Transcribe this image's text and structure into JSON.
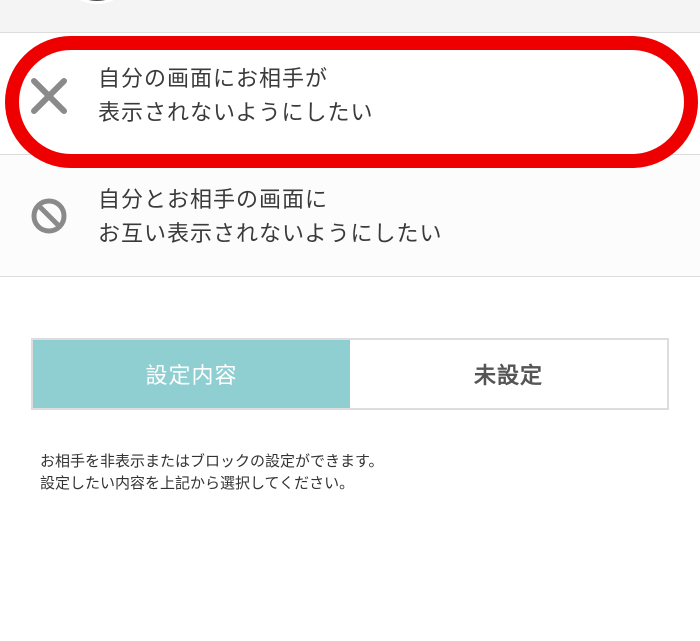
{
  "options": [
    {
      "id": "hide",
      "icon": "close-icon",
      "lines": [
        "自分の画面にお相手が",
        "表示されないようにしたい"
      ],
      "highlighted": true
    },
    {
      "id": "block",
      "icon": "block-icon",
      "lines": [
        "自分とお相手の画面に",
        "お互い表示されないようにしたい"
      ],
      "highlighted": false
    }
  ],
  "setting": {
    "label": "設定内容",
    "value": "未設定"
  },
  "help": {
    "lines": [
      "お相手を非表示またはブロックの設定ができます。",
      "設定したい内容を上記から選択してください。"
    ]
  },
  "colors": {
    "accent": "#8fcfd1",
    "highlight": "#ee0000",
    "icon": "#8a8a8a"
  }
}
